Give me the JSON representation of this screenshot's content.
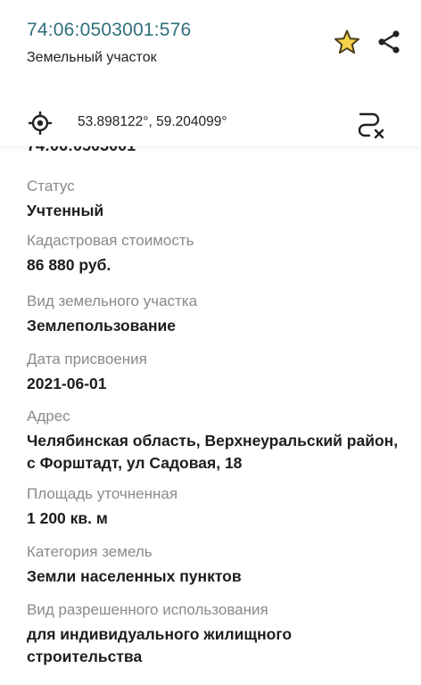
{
  "header": {
    "cadastral_number": "74:06:0503001:576",
    "object_type": "Земельный участок",
    "favorite_icon": "star-icon",
    "favorite_color": "#f4c400",
    "share_icon": "share-icon"
  },
  "coord_bar": {
    "locate_icon": "target-icon",
    "coordinates": "53.898122°, 59.204099°",
    "route_icon": "route-clear-icon"
  },
  "details": {
    "partial_value": "74:06:0503001",
    "fields": [
      {
        "label": "Статус",
        "value": "Учтенный"
      },
      {
        "label": "Кадастровая стоимость",
        "value": "86 880 руб."
      },
      {
        "label": "Вид земельного участка",
        "value": "Землепользование"
      },
      {
        "label": "Дата присвоения",
        "value": "2021-06-01"
      },
      {
        "label": "Адрес",
        "value": "Челябинская область, Верхнеуральский район, с Форштадт, ул Садовая, 18"
      },
      {
        "label": "Площадь уточненная",
        "value": "1 200 кв. м"
      },
      {
        "label": "Категория земель",
        "value": "Земли населенных пунктов"
      },
      {
        "label": "Вид разрешенного использования",
        "value": "для индивидуального жилищного строительства"
      }
    ]
  }
}
